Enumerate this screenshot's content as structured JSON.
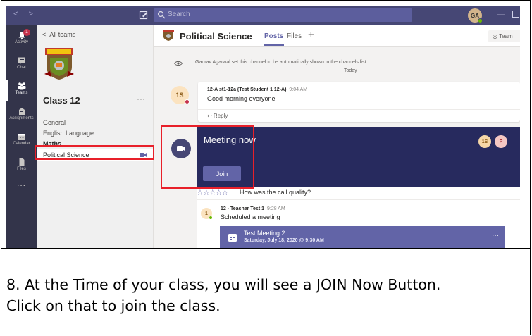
{
  "colors": {
    "titlebar": "#464775",
    "rail": "#33344a",
    "accent": "#6264a7",
    "meeting_banner": "#272a5e",
    "highlight": "#e8202a",
    "status_busy": "#c4314b",
    "status_available": "#6bb700"
  },
  "titlebar": {
    "search_placeholder": "Search",
    "user_initials": "GA"
  },
  "rail": {
    "items": [
      {
        "label": "Activity",
        "icon": "bell-icon",
        "badge": "1"
      },
      {
        "label": "Chat",
        "icon": "chat-icon"
      },
      {
        "label": "Teams",
        "icon": "teams-icon",
        "active": true
      },
      {
        "label": "Assignments",
        "icon": "assignments-icon"
      },
      {
        "label": "Calendar",
        "icon": "calendar-icon"
      },
      {
        "label": "Files",
        "icon": "files-icon"
      }
    ],
    "more": "..."
  },
  "teams_panel": {
    "back_label": "All teams",
    "team_name": "Class 12",
    "more": "···",
    "channels": [
      "General",
      "English Language",
      "Maths",
      "Political Science"
    ]
  },
  "channel_header": {
    "title": "Political Science",
    "tabs": [
      "Posts",
      "Files"
    ],
    "add": "+",
    "team_button": "Team"
  },
  "system_message": {
    "text": "Gaurav Agarwal set this channel to be automatically shown in the channels list.",
    "date": "Today"
  },
  "post": {
    "avatar": "1S",
    "author": "12-A st1-12a (Test Student 1 12-A)",
    "time": "9:04 AM",
    "body": "Good morning everyone",
    "reply": "↩ Reply"
  },
  "meeting": {
    "title": "Meeting now",
    "join_label": "Join",
    "participants": [
      "1S",
      "P"
    ]
  },
  "rating": {
    "stars": "☆☆☆☆☆",
    "question": "How was the call quality?"
  },
  "thread": {
    "avatar": "1",
    "author": "12 - Teacher Test 1",
    "time": "9:28 AM",
    "body": "Scheduled a meeting",
    "chip_title": "Test Meeting 2",
    "chip_date": "Saturday, July 18, 2020 @ 9:30 AM",
    "chip_more": "···"
  },
  "caption": {
    "line1": "8. At the Time of your class, you will see a JOIN Now Button.",
    "line2": "Click on that to join the class."
  }
}
